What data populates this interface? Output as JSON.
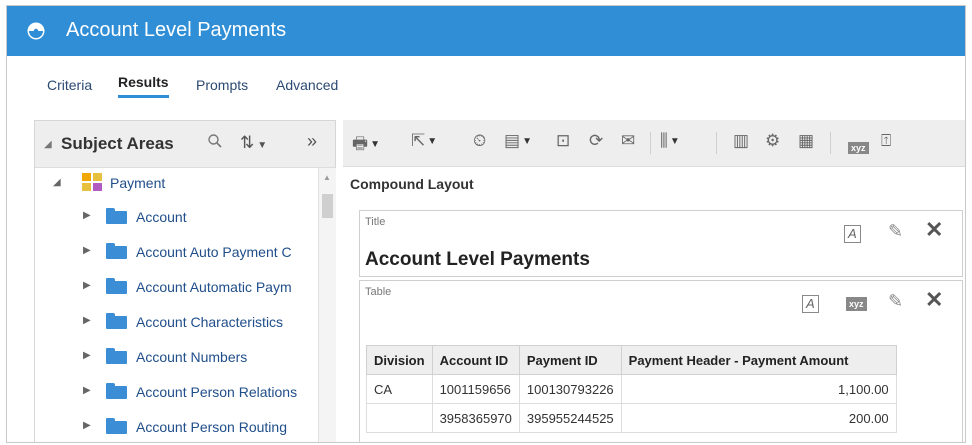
{
  "app": {
    "title": "Account Level Payments"
  },
  "tabs": [
    {
      "label": "Criteria"
    },
    {
      "label": "Results"
    },
    {
      "label": "Prompts"
    },
    {
      "label": "Advanced"
    }
  ],
  "subject_areas": {
    "header": "Subject Areas",
    "root": "Payment",
    "items": [
      {
        "label": "Account"
      },
      {
        "label": "Account Auto Payment C"
      },
      {
        "label": "Account Automatic Paym"
      },
      {
        "label": "Account Characteristics"
      },
      {
        "label": "Account Numbers"
      },
      {
        "label": "Account Person Relations"
      },
      {
        "label": "Account Person Routing"
      }
    ]
  },
  "toolbar": {
    "icons": [
      "print-icon",
      "export-icon",
      "schedule-icon",
      "properties-icon",
      "preview-icon",
      "refresh-icon",
      "mail-icon",
      "new-view-icon",
      "filter-icon",
      "selection-icon",
      "calc-icon",
      "narrative-icon",
      "title-icon"
    ]
  },
  "compound_layout": {
    "label": "Compound Layout",
    "title_view": {
      "label": "Title",
      "title_text": "Account Level Payments"
    },
    "table_view": {
      "label": "Table",
      "columns": [
        "Division",
        "Account ID",
        "Payment ID",
        "Payment Header - Payment Amount"
      ],
      "rows": [
        [
          "CA",
          "1001159656",
          "100130793226",
          "1,100.00"
        ],
        [
          "",
          "3958365970",
          "395955244525",
          "200.00"
        ]
      ]
    }
  },
  "colors": {
    "titlebar": "#2f8ed5",
    "folder": "#3b8ed6",
    "link": "#1f4e8a"
  }
}
